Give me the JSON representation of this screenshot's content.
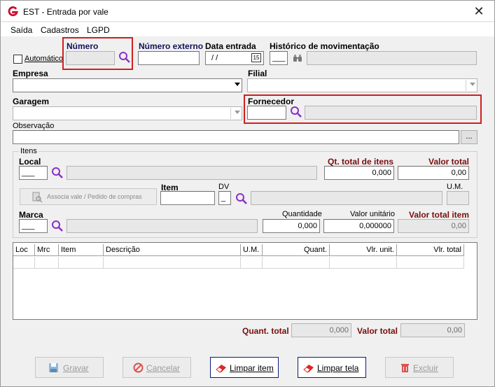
{
  "window": {
    "title": "EST - Entrada por vale",
    "close_glyph": "✕"
  },
  "menu": [
    "Saída",
    "Cadastros",
    "LGPD"
  ],
  "header": {
    "automatico_label": "Automático",
    "numero_label": "Número",
    "numero_value": "",
    "numero_externo_label": "Número externo",
    "numero_externo_value": "",
    "data_entrada_label": "Data entrada",
    "data_entrada_value": "/ /",
    "calendar_glyph": "15",
    "historico_label": "Histórico de movimentação",
    "historico_code": "___",
    "historico_desc": ""
  },
  "empresa": {
    "label": "Empresa",
    "value": ""
  },
  "filial": {
    "label": "Filial",
    "value": ""
  },
  "garagem": {
    "label": "Garagem",
    "value": ""
  },
  "fornecedor": {
    "label": "Fornecedor",
    "code": "",
    "name": ""
  },
  "observacao": {
    "label": "Observação",
    "value": "",
    "ellipsis": "..."
  },
  "itens": {
    "group_label": "Itens",
    "local_label": "Local",
    "local_code": "___",
    "local_desc": "",
    "qt_total_label": "Qt. total de itens",
    "qt_total_value": "0,000",
    "valor_total_label": "Valor total",
    "valor_total_value": "0,00",
    "associa_button": "Associa vale / Pedido de compras",
    "item_label": "Item",
    "item_value": "",
    "dv_label": "DV",
    "dv_value": "_",
    "item_desc": "",
    "um_label": "U.M.",
    "um_value": "",
    "marca_label": "Marca",
    "marca_code": "___",
    "marca_desc": "",
    "quantidade_label": "Quantidade",
    "quantidade_value": "0,000",
    "valor_unitario_label": "Valor unitário",
    "valor_unitario_value": "0,000000",
    "valor_total_item_label": "Valor total item",
    "valor_total_item_value": "0,00"
  },
  "grid": {
    "columns": [
      "Loc",
      "Mrc",
      "Item",
      "Descrição",
      "U.M.",
      "Quant.",
      "Vlr. unit.",
      "Vlr. total"
    ]
  },
  "totals": {
    "quant_total_label": "Quant. total",
    "quant_total_value": "0,000",
    "valor_total_label": "Valor total",
    "valor_total_value": "0,00"
  },
  "buttons": {
    "gravar": "Gravar",
    "cancelar": "Cancelar",
    "limpar_item": "Limpar item",
    "limpar_tela": "Limpar tela",
    "excluir": "Excluir"
  },
  "colors": {
    "highlight_border": "#d21f1f",
    "label_navy": "#12125a",
    "label_dark_red": "#7a0c0c",
    "search_icon": "#8b2fc9"
  }
}
